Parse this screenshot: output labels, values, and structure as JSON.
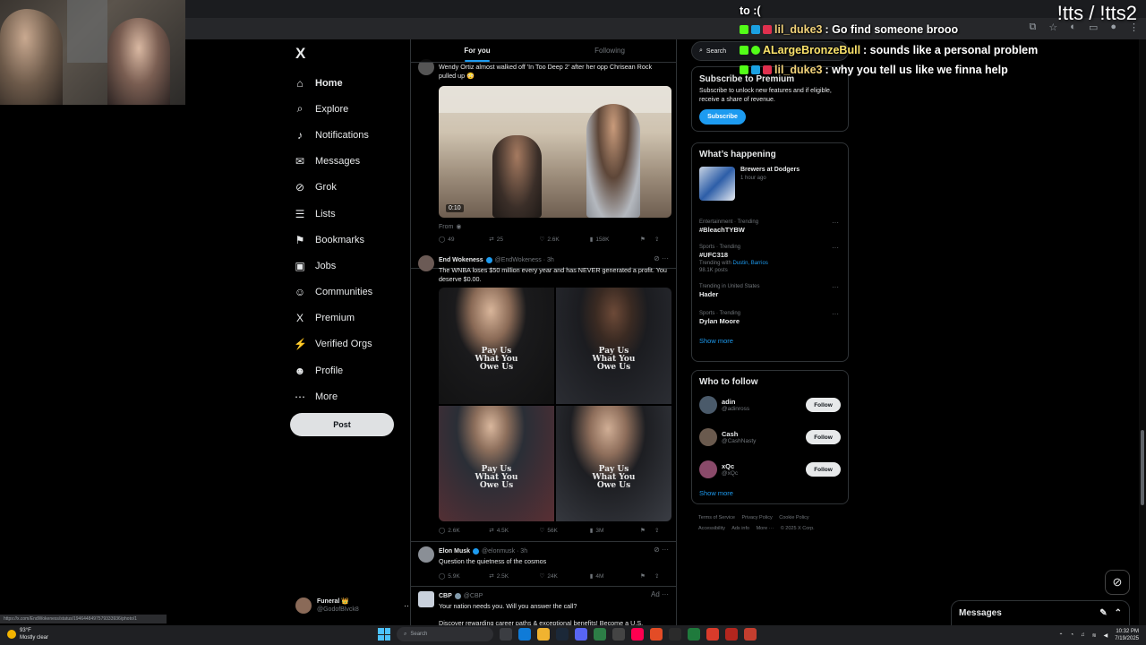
{
  "chat": {
    "partial_line": "to :(",
    "messages": [
      {
        "user": "lil_duke3",
        "text": ": Go find someone brooo"
      },
      {
        "user": "ALargeBronzeBull",
        "text": ": sounds like a personal problem"
      },
      {
        "user": "lil_duke3",
        "text": ": why you tell us like we finna help"
      }
    ],
    "tts_label": "!tts / !tts2"
  },
  "nav": {
    "logo": "X",
    "items": [
      {
        "label": "Home",
        "icon": "⌂"
      },
      {
        "label": "Explore",
        "icon": "⌕"
      },
      {
        "label": "Notifications",
        "icon": "♪"
      },
      {
        "label": "Messages",
        "icon": "✉"
      },
      {
        "label": "Grok",
        "icon": "⊘"
      },
      {
        "label": "Lists",
        "icon": "☰"
      },
      {
        "label": "Bookmarks",
        "icon": "⚑"
      },
      {
        "label": "Jobs",
        "icon": "▣"
      },
      {
        "label": "Communities",
        "icon": "☺"
      },
      {
        "label": "Premium",
        "icon": "X"
      },
      {
        "label": "Verified Orgs",
        "icon": "⚡"
      },
      {
        "label": "Profile",
        "icon": "☻"
      },
      {
        "label": "More",
        "icon": "⋯"
      }
    ],
    "post_label": "Post",
    "account_name": "Funeral 👑",
    "account_handle": "@GodofBlvck8"
  },
  "feed": {
    "tabs": [
      "For you",
      "Following"
    ],
    "tweet1": {
      "text": "Wendy Ortiz almost walked off 'In Too Deep 2' after her opp Chrisean Rock pulled up 😳",
      "duration": "0:10",
      "from": "From",
      "replies": "49",
      "reposts": "25",
      "likes": "2.6K",
      "views": "158K"
    },
    "tweet2": {
      "name": "End Wokeness",
      "handle": "@EndWokeness · 3h",
      "text": "The WNBA loses $50 million every year and has NEVER generated a profit. You deserve $0.00.",
      "shirt_text": "Pay Us What You Owe Us",
      "replies": "2.6K",
      "reposts": "4.5K",
      "likes": "56K",
      "views": "3M"
    },
    "tweet3": {
      "name": "Elon Musk",
      "handle": "@elonmusk · 3h",
      "text": "Question the quietness of the cosmos",
      "replies": "5.9K",
      "reposts": "2.5K",
      "likes": "24K",
      "views": "4M"
    },
    "tweet4": {
      "name": "CBP",
      "handle": "@CBP",
      "ad": "Ad",
      "text": "Your nation needs you. Will you answer the call?",
      "text2": "Discover rewarding career paths & exceptional benefits! Become a U.S."
    }
  },
  "right": {
    "search_placeholder": "Search",
    "premium": {
      "title": "Subscribe to Premium",
      "body": "Subscribe to unlock new features and if eligible, receive a share of revenue.",
      "button": "Subscribe"
    },
    "happening": {
      "title": "What’s happening",
      "event_title": "Brewers at Dodgers",
      "event_time": "1 hour ago",
      "trends": [
        {
          "meta": "Entertainment · Trending",
          "name": "#BleachTYBW",
          "sub": ""
        },
        {
          "meta": "Sports · Trending",
          "name": "#UFC318",
          "sub": "Trending with",
          "links": "Dustin, Barrios",
          "posts": "98.1K posts"
        },
        {
          "meta": "Trending in United States",
          "name": "Hader",
          "sub": ""
        },
        {
          "meta": "Sports · Trending",
          "name": "Dylan Moore",
          "sub": ""
        }
      ],
      "show_more": "Show more"
    },
    "who": {
      "title": "Who to follow",
      "accounts": [
        {
          "name": "adin",
          "handle": "@adinross"
        },
        {
          "name": "Cash",
          "handle": "@CashNasty"
        },
        {
          "name": "xQc",
          "handle": "@xQc"
        }
      ],
      "follow_label": "Follow",
      "show_more": "Show more"
    },
    "footer": [
      "Terms of Service",
      "Privacy Policy",
      "Cookie Policy",
      "Accessibility",
      "Ads info",
      "More ···",
      "© 2025 X Corp."
    ]
  },
  "messages_drawer": {
    "label": "Messages"
  },
  "status_url": "https://x.com/EndWokeness/status/1946448497579333936/photo/1",
  "taskbar": {
    "temp": "93°F",
    "weather": "Mostly clear",
    "search": "Search",
    "time": "10:32 PM",
    "date": "7/19/2025"
  },
  "colors": {
    "accent": "#1d9bf0",
    "kick_green": "#53fc18",
    "background": "#000000",
    "border": "#2f3336"
  }
}
